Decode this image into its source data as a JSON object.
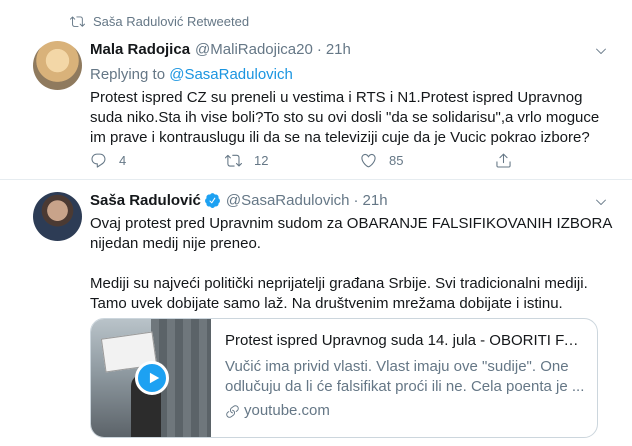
{
  "tweet1": {
    "retweeted_by": "Saša Radulović Retweeted",
    "name": "Mala Radojica",
    "handle": "@MaliRadojica20",
    "separator": "·",
    "time": "21h",
    "replying_prefix": "Replying to",
    "replying_handle": "@SasaRadulovich",
    "text": "Protest ispred CZ su preneli u vestima i RTS i N1.Protest ispred Upravnog\nsuda niko.Sta ih vise boli?To sto su ovi dosli \"da se solidarisu\",a vrlo moguce\nim prave i kontrauslugu ili da se na televiziji cuje da je Vucic pokrao izbore?",
    "replies": "4",
    "retweets": "12",
    "likes": "85"
  },
  "tweet2": {
    "name": "Saša Radulović",
    "handle": "@SasaRadulovich",
    "separator": "·",
    "time": "21h",
    "text": "Ovaj protest pred Upravnim sudom za OBARANJE FALSIFIKOVANIH IZBORA\nnijedan medij nije preneo.\n\nMediji su najveći politički neprijatelji građana Srbije. Svi tradicionalni mediji.\nTamo uvek dobijate samo laž. Na društvenim mrežama dobijate i istinu.",
    "card": {
      "title": "Protest ispred Upravnog suda 14. jula - OBORITI FAL...",
      "description": "Vučić ima privid vlasti. Vlast imaju ove \"sudije\". One odlučuju da li će falsifikat proći ili ne. Cela poenta je ...",
      "domain": "youtube.com"
    }
  },
  "colors": {
    "accent": "#1da1f2",
    "link": "#1b95e0",
    "secondary_text": "#657786",
    "border": "#e6ecf0"
  },
  "icons": [
    "retweet-icon",
    "chevron-down-icon",
    "reply-icon",
    "retweet-icon",
    "like-icon",
    "share-icon",
    "verified-badge-icon",
    "play-icon",
    "link-icon"
  ]
}
